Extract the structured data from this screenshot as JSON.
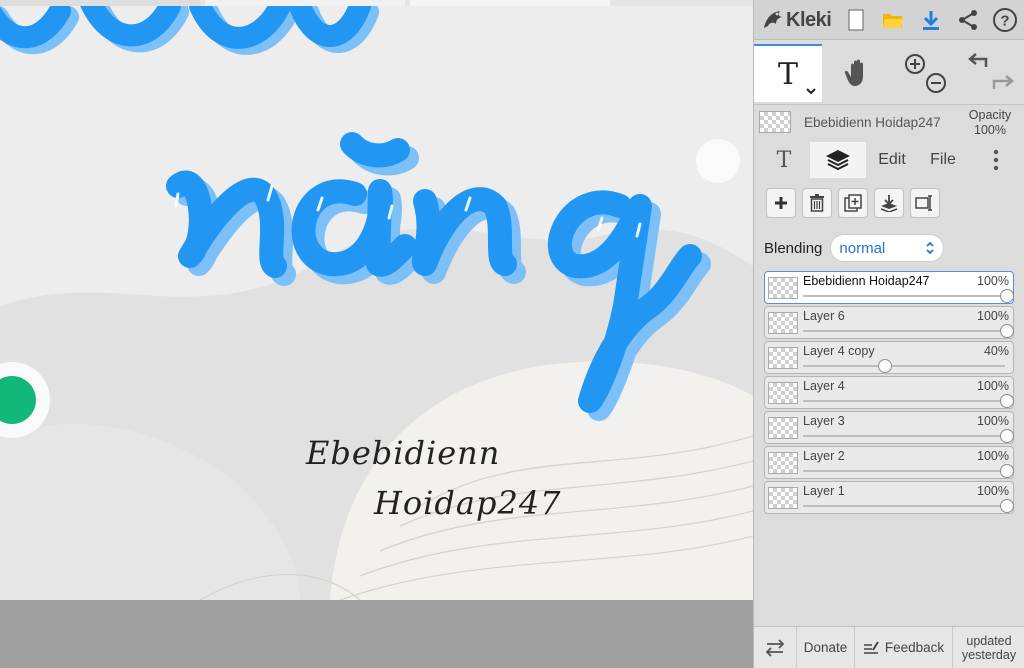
{
  "app": {
    "name": "Kleki"
  },
  "colors": {
    "accent": "#3b8ae6",
    "stroke_blue": "#2196f3",
    "stroke_blue_light": "#7cc0f7",
    "green": "#12b77a"
  },
  "canvas": {
    "word": "năng",
    "signature_line1": "Ebebidienn",
    "signature_line2": "Hoidap247"
  },
  "topbar": {
    "icons": [
      "new-file-icon",
      "open-folder-icon",
      "download-icon",
      "share-icon",
      "help-icon"
    ],
    "help_glyph": "?"
  },
  "tools": {
    "active": "text-tool",
    "text_glyph": "T"
  },
  "current_layer": {
    "name": "Ebebidienn Hoidap247",
    "opacity_label": "Opacity",
    "opacity_value": "100%"
  },
  "tabs": {
    "text_glyph": "T",
    "edit": "Edit",
    "file": "File"
  },
  "blending": {
    "label": "Blending",
    "value": "normal"
  },
  "layers": [
    {
      "name": "Ebebidienn Hoidap247",
      "opacity": "100%",
      "level": 1.0,
      "active": true
    },
    {
      "name": "Layer 6",
      "opacity": "100%",
      "level": 1.0,
      "active": false
    },
    {
      "name": "Layer 4 copy",
      "opacity": "40%",
      "level": 0.4,
      "active": false
    },
    {
      "name": "Layer 4",
      "opacity": "100%",
      "level": 1.0,
      "active": false
    },
    {
      "name": "Layer 3",
      "opacity": "100%",
      "level": 1.0,
      "active": false
    },
    {
      "name": "Layer 2",
      "opacity": "100%",
      "level": 1.0,
      "active": false
    },
    {
      "name": "Layer 1",
      "opacity": "100%",
      "level": 1.0,
      "active": false
    }
  ],
  "bottom": {
    "donate": "Donate",
    "feedback": "Feedback",
    "updated": "updated yesterday"
  }
}
